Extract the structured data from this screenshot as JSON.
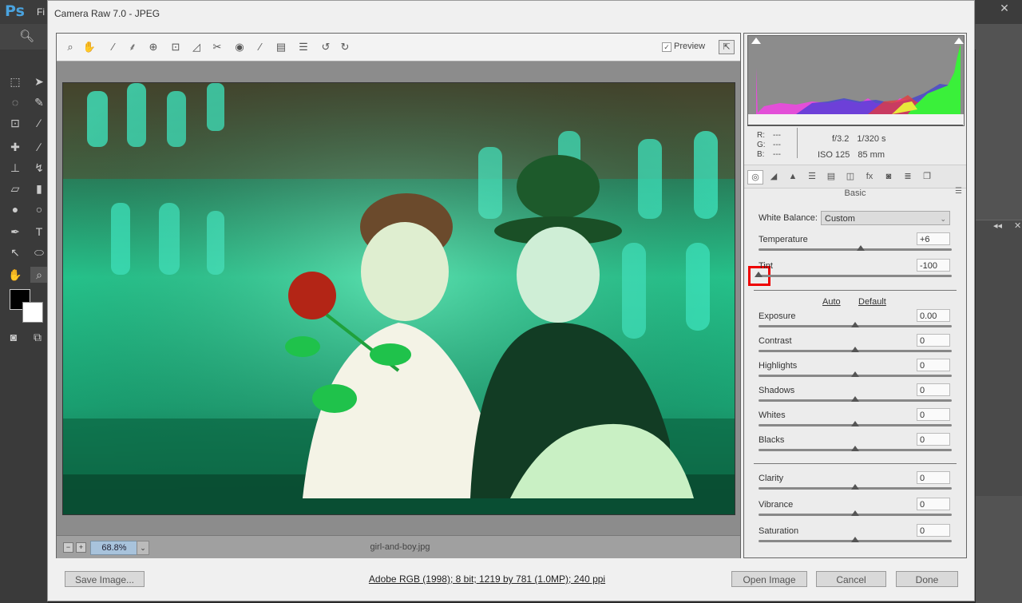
{
  "photoshop": {
    "logo": "Ps",
    "menu_first": "Fi",
    "close_glyph": "✕"
  },
  "dialog": {
    "title": "Camera Raw 7.0  -  JPEG",
    "preview_label": "Preview",
    "zoom_level": "68.8%",
    "zoom_minus": "−",
    "zoom_plus": "+",
    "filename": "girl-and-boy.jpg",
    "workflow_info": "Adobe RGB (1998); 8 bit; 1219 by 781 (1.0MP); 240 ppi",
    "buttons": {
      "save_image": "Save Image...",
      "open_image": "Open Image",
      "cancel": "Cancel",
      "done": "Done"
    }
  },
  "camera_info": {
    "r_label": "R:",
    "g_label": "G:",
    "b_label": "B:",
    "r_value": "---",
    "g_value": "---",
    "b_value": "---",
    "aperture": "f/3.2",
    "shutter": "1/320 s",
    "iso": "ISO 125",
    "focal": "85 mm"
  },
  "panel": {
    "section_title": "Basic",
    "white_balance_label": "White Balance:",
    "white_balance_value": "Custom",
    "auto_link": "Auto",
    "default_link": "Default",
    "sliders": [
      {
        "label": "Temperature",
        "value": "+6",
        "position": 0.53
      },
      {
        "label": "Tint",
        "value": "-100",
        "position": 0.0
      },
      {
        "label": "Exposure",
        "value": "0.00",
        "position": 0.5
      },
      {
        "label": "Contrast",
        "value": "0",
        "position": 0.5
      },
      {
        "label": "Highlights",
        "value": "0",
        "position": 0.5
      },
      {
        "label": "Shadows",
        "value": "0",
        "position": 0.5
      },
      {
        "label": "Whites",
        "value": "0",
        "position": 0.5
      },
      {
        "label": "Blacks",
        "value": "0",
        "position": 0.5
      },
      {
        "label": "Clarity",
        "value": "0",
        "position": 0.5
      },
      {
        "label": "Vibrance",
        "value": "0",
        "position": 0.5
      },
      {
        "label": "Saturation",
        "value": "0",
        "position": 0.5
      }
    ]
  },
  "colors": {
    "accent_highlight": "#e00000",
    "zoom_field": "#a8c3dc",
    "photo_tint": "#22d39a"
  }
}
